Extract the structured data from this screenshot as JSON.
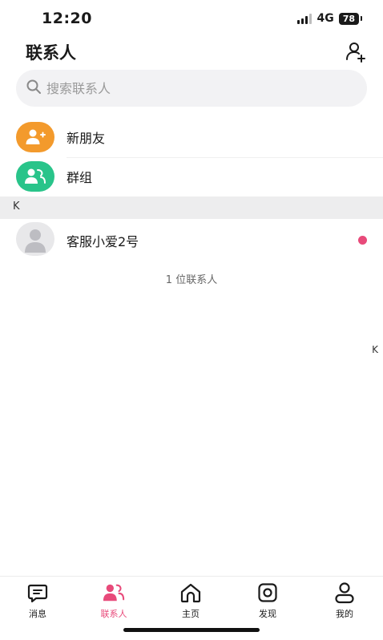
{
  "status_bar": {
    "time": "12:20",
    "network": "4G",
    "battery": "78"
  },
  "header": {
    "title": "联系人",
    "add_contact_icon": "add-person-icon"
  },
  "search": {
    "placeholder": "搜索联系人",
    "icon": "search-icon"
  },
  "entries": [
    {
      "label": "新朋友",
      "icon": "new-friend-icon",
      "color": "#f39a2c"
    },
    {
      "label": "群组",
      "icon": "group-icon",
      "color": "#29c48a"
    }
  ],
  "section": {
    "letter": "K"
  },
  "contacts": [
    {
      "name": "客服小爱2号",
      "unread": true,
      "dot_color": "#e84a7a"
    }
  ],
  "contact_count": "1 位联系人",
  "index_bar": {
    "letters": [
      "K"
    ]
  },
  "tabs": [
    {
      "label": "消息",
      "icon": "message-icon",
      "active": false
    },
    {
      "label": "联系人",
      "icon": "contacts-icon",
      "active": true
    },
    {
      "label": "主页",
      "icon": "home-icon",
      "active": false
    },
    {
      "label": "发现",
      "icon": "discover-icon",
      "active": false
    },
    {
      "label": "我的",
      "icon": "profile-icon",
      "active": false
    }
  ],
  "colors": {
    "accent": "#e84a7a",
    "orange": "#f39a2c",
    "green": "#29c48a"
  }
}
